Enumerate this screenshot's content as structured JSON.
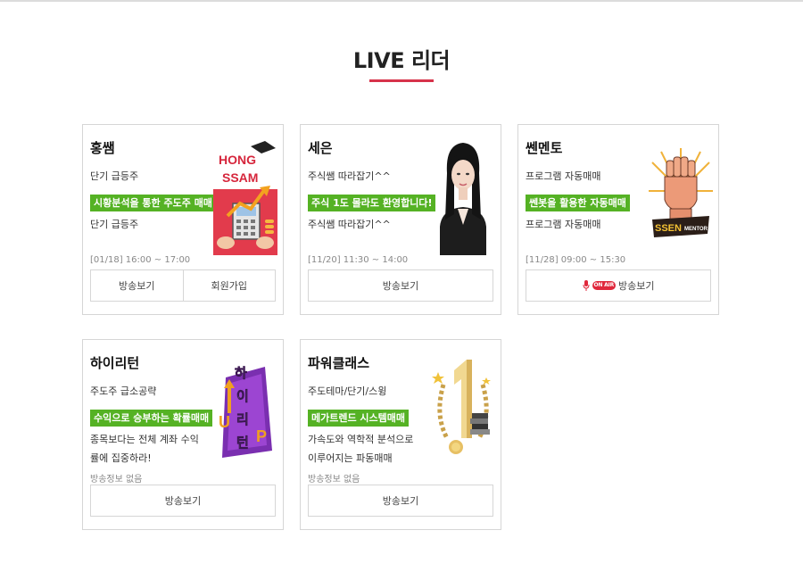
{
  "section_title": "LIVE 리더",
  "cards": [
    {
      "name": "홍쌤",
      "subtitle": "단기 급등주",
      "badge": "시황분석을 통한 주도주 매매",
      "desc": "단기 급등주",
      "time": "[01/18] 16:00 ~ 17:00",
      "image_text": [
        "HONG",
        "SSAM"
      ],
      "buttons": [
        "방송보기",
        "회원가입"
      ]
    },
    {
      "name": "세은",
      "subtitle": "주식쌤 따라잡기^^",
      "badge": "주식 1도 몰라도 환영합니다!",
      "desc": "주식쌤 따라잡기^^",
      "time": "[11/20] 11:30 ~ 14:00",
      "buttons": [
        "방송보기"
      ]
    },
    {
      "name": "쎈멘토",
      "subtitle": "프로그램 자동매매",
      "badge": "쎈봇을 활용한 자동매매",
      "desc": "프로그램 자동매매",
      "time": "[11/28] 09:00 ~ 15:30",
      "image_text": [
        "SSEN",
        "MENTOR"
      ],
      "onair": "ON AIR",
      "buttons": [
        "방송보기"
      ]
    },
    {
      "name": "하이리턴",
      "subtitle": "주도주 급소공략",
      "badge": "수익으로 승부하는 확률매매",
      "desc": "종목보다는 전체 계좌 수익률에 집중하라!",
      "time": "방송정보 없음",
      "image_text": [
        "하",
        "이",
        "리",
        "턴",
        "U",
        "P"
      ],
      "buttons": [
        "방송보기"
      ]
    },
    {
      "name": "파워클래스",
      "subtitle": "주도테마/단기/스윙",
      "badge": "메가트렌드 시스템매매",
      "desc": "가속도와 역학적 분석으로 이루어지는 파동매매",
      "time": "방송정보 없음",
      "buttons": [
        "방송보기"
      ]
    }
  ]
}
